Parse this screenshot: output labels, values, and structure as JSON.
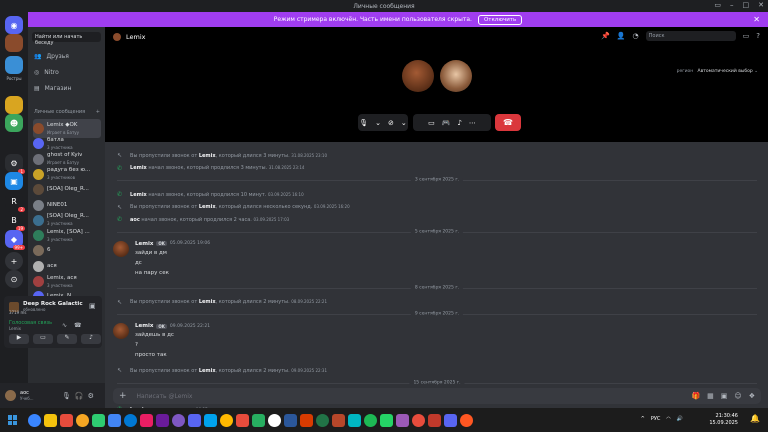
{
  "window": {
    "title": "Личные сообщения"
  },
  "streamer_banner": {
    "text": "Режим стримера включён. Часть имени пользователя скрыта.",
    "button": "Отключить"
  },
  "servers": [
    {
      "name": "discord-home",
      "color": "#5865f2",
      "glyph": "◉"
    },
    {
      "name": "server-avatar",
      "color": "#8a4b2c",
      "glyph": ""
    },
    {
      "name": "server-rostry",
      "color": "#3a8fd6",
      "glyph": "",
      "label": "Ростры"
    },
    {
      "name": "server-yellow",
      "color": "#d9a520",
      "glyph": ""
    },
    {
      "name": "server-green",
      "color": "#3ba55c",
      "glyph": "☻"
    },
    {
      "name": "server-dark",
      "color": "#2b2d31",
      "glyph": "⚙",
      "badge": "1"
    },
    {
      "name": "server-blue",
      "color": "#1e88e5",
      "glyph": "▣"
    },
    {
      "name": "server-r",
      "color": "#1e1f22",
      "glyph": "R",
      "badge": "2"
    },
    {
      "name": "server-b",
      "color": "#1e1f22",
      "glyph": "B",
      "badge": "19"
    },
    {
      "name": "server-cap",
      "color": "#5865f2",
      "glyph": "◆",
      "badge": "99+"
    }
  ],
  "dm_panel": {
    "search": "Найти или начать беседу",
    "nav": [
      "Друзья",
      "Nitro",
      "Магазин"
    ],
    "section": "Личные сообщения",
    "items": [
      {
        "name": "Lemix",
        "tag": "OK",
        "sub": "Играет в Батуу",
        "color": "#8a4b2c",
        "selected": true
      },
      {
        "name": "батла",
        "sub": "3 участника",
        "color": "#5865f2"
      },
      {
        "name": "ghost of Kyiv",
        "sub": "Играет в Батуу",
        "color": "#6d6f78"
      },
      {
        "name": "радуга без ю...",
        "sub": "3 участников",
        "color": "#c9a227"
      },
      {
        "name": "[SOA] Oleg_R...",
        "sub": "",
        "color": "#5c4a3a"
      },
      {
        "name": "NINE01",
        "sub": "",
        "color": "#7a7f87"
      },
      {
        "name": "[SOA] Oleg_R...",
        "sub": "3 участника",
        "color": "#3b6e8f"
      },
      {
        "name": "Lemix, [SOA] ...",
        "sub": "3 участника",
        "color": "#2e7d5b"
      },
      {
        "name": "6",
        "sub": "",
        "color": "#7a6a5a"
      },
      {
        "name": "ася",
        "sub": "",
        "color": "#b0b0b0"
      },
      {
        "name": "Lemix, ася",
        "sub": "3 участника",
        "color": "#a04040"
      },
      {
        "name": "Lemix, N...",
        "sub": "",
        "color": "#5865f2"
      }
    ]
  },
  "activity": {
    "game": "Deep Rock Galactic",
    "status": "обновлено",
    "ping": "3719 ms",
    "voice_label": "Голосовая связь",
    "voice_sub": "Lemix"
  },
  "user": {
    "name": "аос",
    "status": "Учеб..."
  },
  "header": {
    "name": "Lemix",
    "search": "Поиск"
  },
  "call": {
    "output_label": "регион",
    "output_value": "Автоматический выбор"
  },
  "messages": [
    {
      "type": "missed",
      "user": "Lemix",
      "text": "Вы пропустили звонок от",
      "suffix": ", который длился 3 минуты.",
      "time": "31.08.2025 23:10"
    },
    {
      "type": "call",
      "user": "Lemix",
      "text": "",
      "suffix": " начал звонок, который продлился 3 минуты.",
      "time": "31.08.2025 23:14"
    },
    {
      "type": "divider",
      "text": "3 сентября 2025 г."
    },
    {
      "type": "call",
      "user": "Lemix",
      "text": "",
      "suffix": " начал звонок, который продлился 10 минут.",
      "time": "03.09.2025 16:10"
    },
    {
      "type": "missed",
      "user": "Lemix",
      "text": "Вы пропустили звонок от",
      "suffix": ", который длился несколько секунд.",
      "time": "03.09.2025 16:20"
    },
    {
      "type": "call",
      "user": "аос",
      "text": "",
      "suffix": " начал звонок, который продлился 2 часа.",
      "time": "03.09.2025 17:03"
    },
    {
      "type": "divider",
      "text": "5 сентября 2025 г."
    },
    {
      "type": "post",
      "user": "Lemix",
      "tag": "OK",
      "time": "05.09.2025 19:06",
      "lines": [
        "зайди в дм",
        "дс",
        "на пару сек"
      ]
    },
    {
      "type": "divider",
      "text": "8 сентября 2025 г."
    },
    {
      "type": "missed",
      "user": "Lemix",
      "text": "Вы пропустили звонок от",
      "suffix": ", который длился 2 минуты.",
      "time": "08.09.2025 22:21"
    },
    {
      "type": "divider",
      "text": "9 сентября 2025 г."
    },
    {
      "type": "post",
      "user": "Lemix",
      "tag": "OK",
      "time": "09.09.2025 22:21",
      "lines": [
        "зайдешь в дс",
        "?",
        "просто так"
      ]
    },
    {
      "type": "missed",
      "user": "Lemix",
      "text": "Вы пропустили звонок от",
      "suffix": ", который длился 2 минуты.",
      "time": "09.09.2025 22:31"
    },
    {
      "type": "divider",
      "text": "15 сентября 2025 г."
    },
    {
      "type": "missed",
      "user": "Lemix",
      "text": "Вы пропустили звонок от",
      "suffix": ", который длился 2 минуты.",
      "time": "16:06"
    },
    {
      "type": "call",
      "user": "Lemix",
      "text": "",
      "suffix": " начинает звонок.",
      "time": "16:27"
    }
  ],
  "composer": {
    "placeholder": "Написать @Lemix"
  },
  "taskbar": {
    "lang": "РУС",
    "time": "21:30:46",
    "date": "15.09.2025",
    "icons": [
      "#3a86ff",
      "#f4c20d",
      "#e74c3c",
      "#f5a623",
      "#2ecc71",
      "#4285f4",
      "#0078d4",
      "#e91e63",
      "#6a1b9a",
      "#7e57c2",
      "#5865f2",
      "#00a2ed",
      "#ffb900",
      "#e74c3c",
      "#27ae60",
      "#ffffff",
      "#2b579a",
      "#d83b01",
      "#217346",
      "#b7472a",
      "#00b7c3",
      "#1db954",
      "#25d366",
      "#9b59b6",
      "#e74c3c",
      "#c0392b",
      "#5865f2",
      "#ff5722"
    ]
  }
}
